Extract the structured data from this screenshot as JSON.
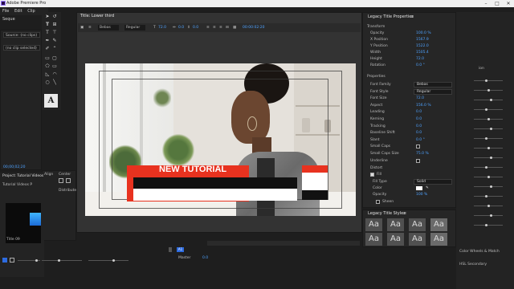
{
  "app": {
    "title": "Adobe Premiere Pro"
  },
  "menu": [
    "File",
    "Edit",
    "Clip",
    "Seque"
  ],
  "source_panel": {
    "label": "Source: (no clips)",
    "effect_label": "(no clip selected)",
    "timecode": "00;00;02;20"
  },
  "project_panel": {
    "title": "Project: Tutorial Videos",
    "subtitle": "Tutorial Videos P",
    "item_label": "Title 09"
  },
  "align_panel": {
    "align": "Align",
    "center": "Center",
    "distribute": "Distribute"
  },
  "title_window": {
    "tab": "Title: Lower third",
    "font": "Bebas",
    "style": "Regular",
    "size": "72.0",
    "kerning": "0.0",
    "leading": "0.0",
    "timecode": "00:00:02:20"
  },
  "video": {
    "banner_text": "NEW TUTORIAL"
  },
  "legacy_properties": {
    "title": "Legacy Title Properties",
    "transform_label": "Transform",
    "properties_label": "Properties",
    "transform": [
      {
        "k": "Opacity",
        "v": "100.0 %"
      },
      {
        "k": "X Position",
        "v": "1567.9"
      },
      {
        "k": "Y Position",
        "v": "1522.0"
      },
      {
        "k": "Width",
        "v": "1505.4"
      },
      {
        "k": "Height",
        "v": "72.0"
      },
      {
        "k": "Rotation",
        "v": "0.0 °"
      }
    ],
    "props": [
      {
        "k": "Font Family",
        "v": "Bebas",
        "type": "select"
      },
      {
        "k": "Font Style",
        "v": "Regular",
        "type": "select"
      },
      {
        "k": "Font Size",
        "v": "72.0"
      },
      {
        "k": "Aspect",
        "v": "156.0 %"
      },
      {
        "k": "Leading",
        "v": "0.0"
      },
      {
        "k": "Kerning",
        "v": "0.0"
      },
      {
        "k": "Tracking",
        "v": "0.0"
      },
      {
        "k": "Baseline Shift",
        "v": "0.0"
      },
      {
        "k": "Slant",
        "v": "0.0 °"
      },
      {
        "k": "Small Caps",
        "v": "",
        "type": "check"
      },
      {
        "k": "Small Caps Size",
        "v": "75.0 %"
      },
      {
        "k": "Underline",
        "v": "",
        "type": "check"
      }
    ],
    "distort": "Distort",
    "fill": "Fill",
    "fill_type_label": "Fill Type",
    "fill_type": "Solid",
    "color_label": "Color",
    "opacity_label": "Opacity",
    "opacity": "100 %",
    "sheen": "Sheen"
  },
  "styles_panel": {
    "title": "Legacy Title Styles",
    "swatch": "Aa"
  },
  "right_panel": {
    "items": [
      "Color Wheels & Match",
      "HSL Secondary"
    ],
    "top_label": "ion"
  },
  "timeline": {
    "track_a1": "A1",
    "master": "Master",
    "master_val": "0.0"
  },
  "colors": {
    "accent_blue": "#4ea2ff",
    "banner_red": "#e8321f",
    "panel": "#232323"
  }
}
